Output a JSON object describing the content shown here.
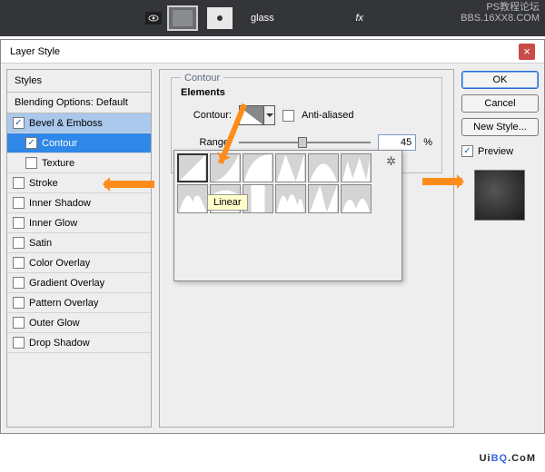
{
  "top": {
    "layer_name": "glass",
    "fx_label": "fx",
    "watermark_line1": "PS教程论坛",
    "watermark_line2": "BBS.16XX8.COM"
  },
  "dialog": {
    "title": "Layer Style",
    "close": "×"
  },
  "styles": {
    "header": "Styles",
    "subheader": "Blending Options: Default",
    "items": [
      {
        "label": "Bevel & Emboss",
        "checked": true,
        "indent": false,
        "selected": "sel2"
      },
      {
        "label": "Contour",
        "checked": true,
        "indent": true,
        "selected": "sel"
      },
      {
        "label": "Texture",
        "checked": false,
        "indent": true,
        "selected": ""
      },
      {
        "label": "Stroke",
        "checked": false,
        "indent": false,
        "selected": ""
      },
      {
        "label": "Inner Shadow",
        "checked": false,
        "indent": false,
        "selected": ""
      },
      {
        "label": "Inner Glow",
        "checked": false,
        "indent": false,
        "selected": ""
      },
      {
        "label": "Satin",
        "checked": false,
        "indent": false,
        "selected": ""
      },
      {
        "label": "Color Overlay",
        "checked": false,
        "indent": false,
        "selected": ""
      },
      {
        "label": "Gradient Overlay",
        "checked": false,
        "indent": false,
        "selected": ""
      },
      {
        "label": "Pattern Overlay",
        "checked": false,
        "indent": false,
        "selected": ""
      },
      {
        "label": "Outer Glow",
        "checked": false,
        "indent": false,
        "selected": ""
      },
      {
        "label": "Drop Shadow",
        "checked": false,
        "indent": false,
        "selected": ""
      }
    ]
  },
  "center": {
    "group_title": "Contour",
    "section": "Elements",
    "contour_label": "Contour:",
    "antialiased_label": "Anti-aliased",
    "antialiased_checked": false,
    "range_label": "Range:",
    "range_value": "45",
    "range_unit": "%",
    "popup": {
      "tooltip": "Linear",
      "gear": "✲"
    }
  },
  "right": {
    "ok": "OK",
    "cancel": "Cancel",
    "new_style": "New Style...",
    "preview_label": "Preview",
    "preview_checked": true
  },
  "footer": {
    "logo_a": "Ui",
    "logo_b": "BQ",
    "logo_c": ".CoM"
  }
}
